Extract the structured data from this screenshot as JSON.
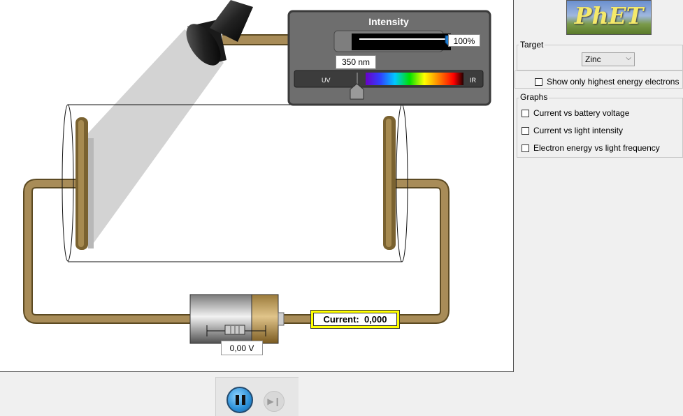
{
  "simulation": {
    "intensity_panel": {
      "title": "Intensity",
      "intensity_level": 1.0,
      "intensity_value": "100%",
      "wavelength_value": "350 nm",
      "uv_label": "UV",
      "ir_label": "IR"
    },
    "battery": {
      "voltage_value": "0,00 V"
    },
    "ammeter": {
      "current_label": "Current:  0,000"
    }
  },
  "controls": {
    "logo_text": "PhET",
    "target": {
      "title": "Target",
      "selected": "Zinc"
    },
    "show_highest_energy_label": "Show only highest energy electrons",
    "graphs": {
      "title": "Graphs",
      "items": [
        {
          "label": "Current vs battery voltage",
          "checked": false
        },
        {
          "label": "Current vs light intensity",
          "checked": false
        },
        {
          "label": "Electron energy vs light frequency",
          "checked": false
        }
      ]
    }
  },
  "playback": {
    "pause_icon": "pause-icon",
    "step_icon": "step-forward-icon"
  }
}
